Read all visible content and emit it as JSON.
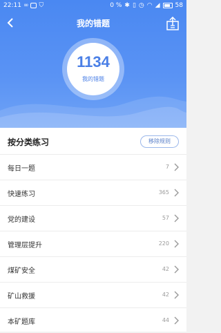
{
  "status": {
    "time": "22:11",
    "network": "0 %",
    "battery": "58"
  },
  "nav": {
    "title": "我的错题"
  },
  "summary": {
    "count": "1134",
    "label": "我的错题"
  },
  "section": {
    "title": "按分类练习",
    "rules_button": "移除规则"
  },
  "categories": [
    {
      "label": "每日一题",
      "count": "7"
    },
    {
      "label": "快速练习",
      "count": "365"
    },
    {
      "label": "党的建设",
      "count": "57"
    },
    {
      "label": "管理层提升",
      "count": "220"
    },
    {
      "label": "煤矿安全",
      "count": "42"
    },
    {
      "label": "矿山救援",
      "count": "42"
    },
    {
      "label": "本矿题库",
      "count": "44"
    }
  ],
  "colors": {
    "header": "#4a88f2",
    "accent": "#4a7fe6"
  }
}
